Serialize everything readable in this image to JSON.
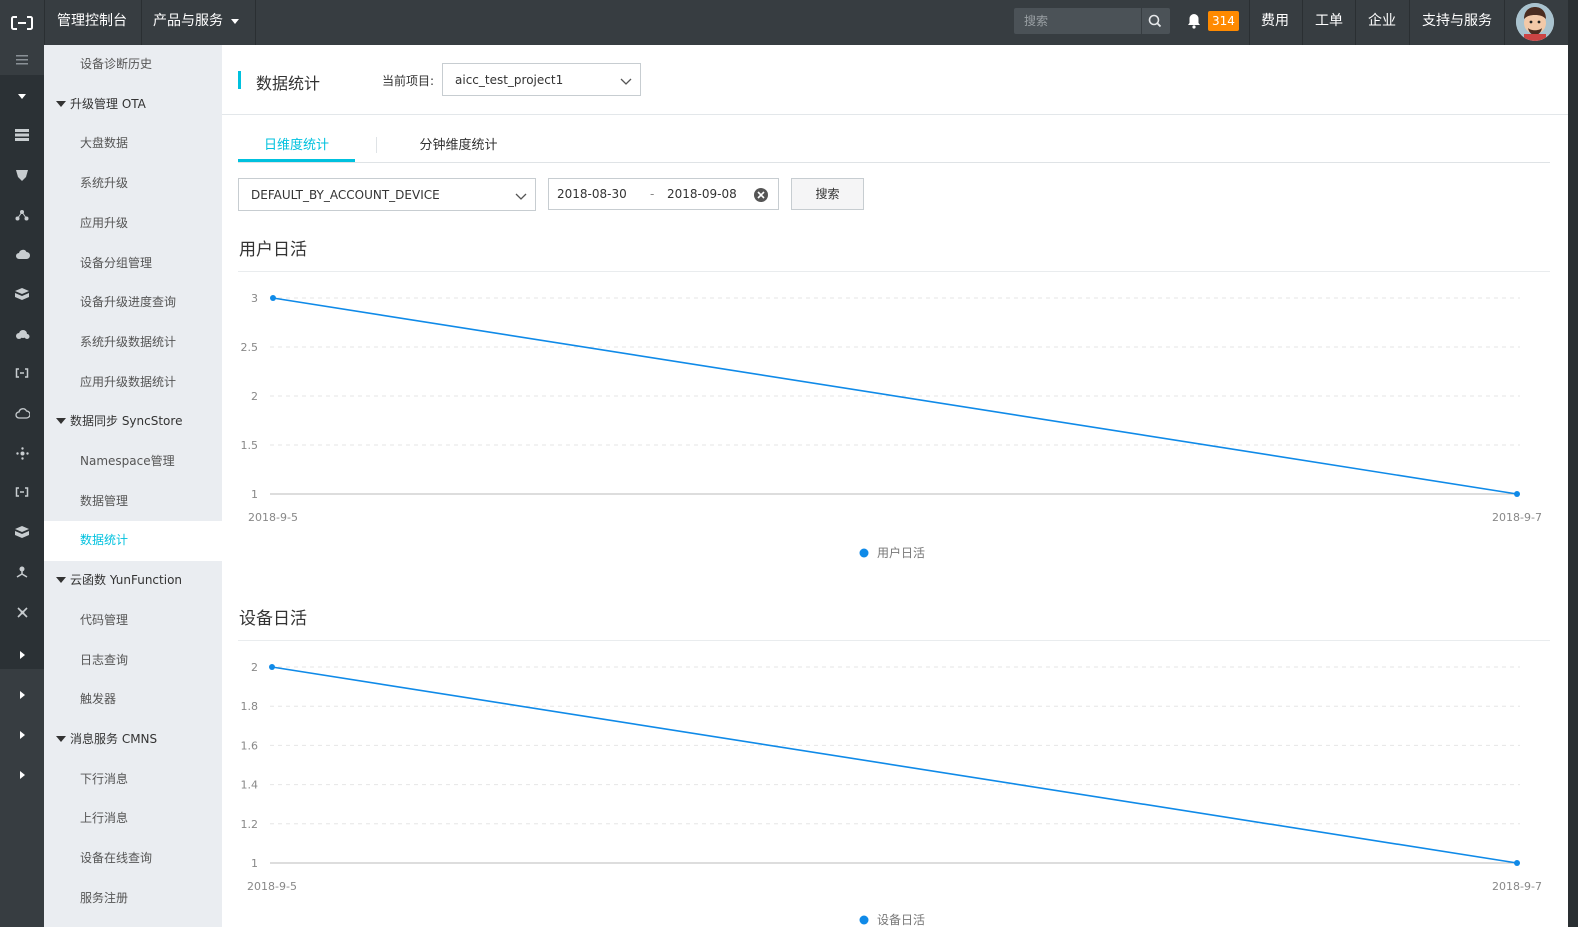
{
  "topbar": {
    "console": "管理控制台",
    "products": "产品与服务",
    "search_placeholder": "搜索",
    "notifications": "314",
    "fees": "费用",
    "tickets": "工单",
    "enterprise": "企业",
    "support": "支持与服务"
  },
  "sidebar": {
    "items": [
      {
        "type": "sub",
        "label": "设备诊断历史"
      },
      {
        "type": "group",
        "label": "升级管理 OTA"
      },
      {
        "type": "sub",
        "label": "大盘数据"
      },
      {
        "type": "sub",
        "label": "系统升级"
      },
      {
        "type": "sub",
        "label": "应用升级"
      },
      {
        "type": "sub",
        "label": "设备分组管理"
      },
      {
        "type": "sub",
        "label": "设备升级进度查询"
      },
      {
        "type": "sub",
        "label": "系统升级数据统计"
      },
      {
        "type": "sub",
        "label": "应用升级数据统计"
      },
      {
        "type": "group",
        "label": "数据同步 SyncStore"
      },
      {
        "type": "sub",
        "label": "Namespace管理"
      },
      {
        "type": "sub",
        "label": "数据管理"
      },
      {
        "type": "sub",
        "label": "数据统计",
        "active": true
      },
      {
        "type": "group",
        "label": "云函数 YunFunction"
      },
      {
        "type": "sub",
        "label": "代码管理"
      },
      {
        "type": "sub",
        "label": "日志查询"
      },
      {
        "type": "sub",
        "label": "触发器"
      },
      {
        "type": "group",
        "label": "消息服务 CMNS"
      },
      {
        "type": "sub",
        "label": "下行消息"
      },
      {
        "type": "sub",
        "label": "上行消息"
      },
      {
        "type": "sub",
        "label": "设备在线查询"
      },
      {
        "type": "sub",
        "label": "服务注册"
      }
    ]
  },
  "page": {
    "title": "数据统计",
    "project_label": "当前项目:",
    "project_value": "aicc_test_project1"
  },
  "tabs": [
    {
      "label": "日维度统计",
      "active": true
    },
    {
      "label": "分钟维度统计",
      "active": false
    }
  ],
  "filters": {
    "type_value": "DEFAULT_BY_ACCOUNT_DEVICE",
    "date_start": "2018-08-30",
    "date_sep": "-",
    "date_end": "2018-09-08",
    "search_button": "搜索"
  },
  "colors": {
    "accent": "#00c1de",
    "line": "#0f8ae8",
    "topbar": "#373d41",
    "badge": "#ff8a00"
  },
  "chart_data": [
    {
      "type": "line",
      "title": "用户日活",
      "x": [
        "2018-9-5",
        "2018-9-7"
      ],
      "series": [
        {
          "name": "用户日活",
          "values": [
            3,
            1
          ]
        }
      ],
      "yticks": [
        "1",
        "1.5",
        "2",
        "2.5",
        "3"
      ],
      "ylim": [
        1,
        3
      ],
      "grid": true,
      "legend": "bottom-center"
    },
    {
      "type": "line",
      "title": "设备日活",
      "x": [
        "2018-9-5",
        "2018-9-7"
      ],
      "series": [
        {
          "name": "设备日活",
          "values": [
            2,
            1
          ]
        }
      ],
      "yticks": [
        "1",
        "1.2",
        "1.4",
        "1.6",
        "1.8",
        "2"
      ],
      "ylim": [
        1,
        2
      ],
      "grid": true,
      "legend": "bottom-center"
    }
  ]
}
